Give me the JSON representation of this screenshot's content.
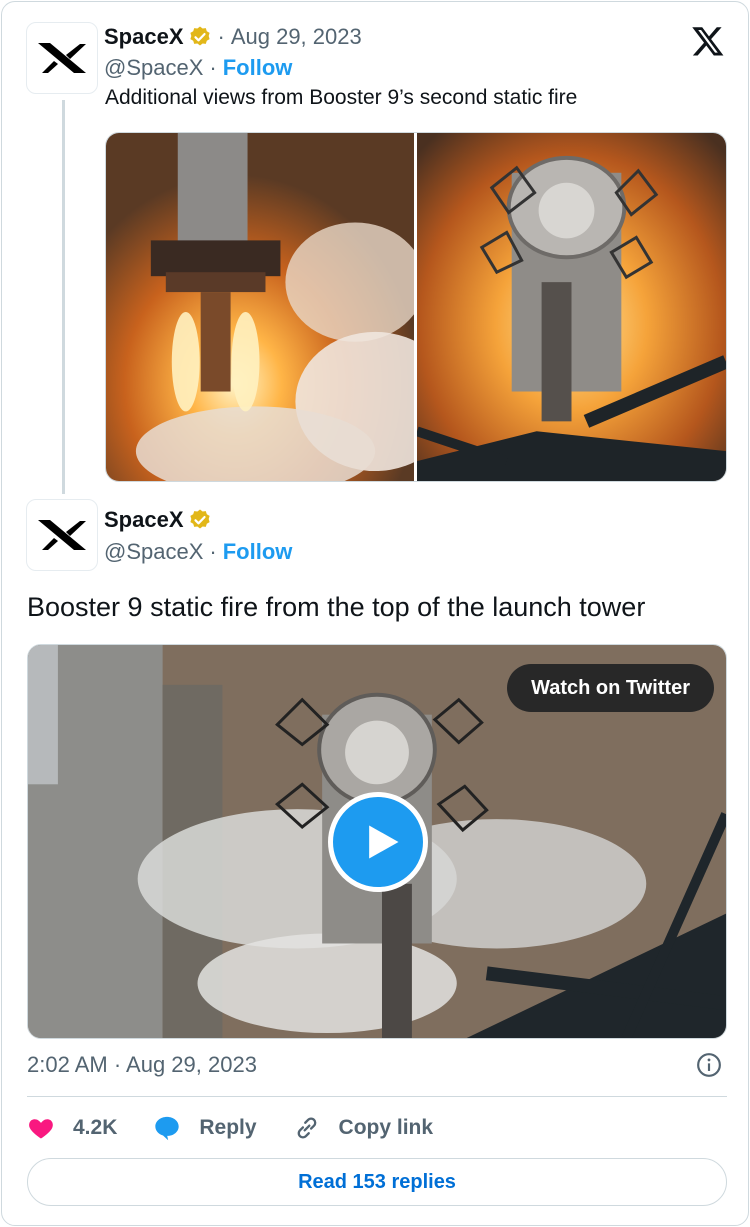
{
  "quoted_tweet": {
    "author_name": "SpaceX",
    "separator": "·",
    "date": "Aug 29, 2023",
    "handle": "@SpaceX",
    "handle_separator": "·",
    "follow_label": "Follow",
    "text": "Additional views from Booster 9’s second static fire",
    "media": [
      {
        "icon": "booster-static-fire-photo"
      },
      {
        "icon": "booster-top-view-photo"
      }
    ]
  },
  "main_tweet": {
    "author_name": "SpaceX",
    "handle": "@SpaceX",
    "handle_separator": "·",
    "follow_label": "Follow",
    "text": "Booster 9 static fire from the top of the launch tower",
    "video": {
      "watch_label": "Watch on Twitter",
      "play_icon": "play-icon"
    },
    "timestamp": "2:02 AM · Aug 29, 2023"
  },
  "actions": {
    "like_count": "4.2K",
    "reply_label": "Reply",
    "copy_link_label": "Copy link"
  },
  "read_replies_label": "Read 153 replies",
  "colors": {
    "accent": "#1d9bf0",
    "like": "#f91880",
    "verified": "#e2b719",
    "text": "#0f1419",
    "muted": "#536471",
    "border": "#cfd9de"
  }
}
